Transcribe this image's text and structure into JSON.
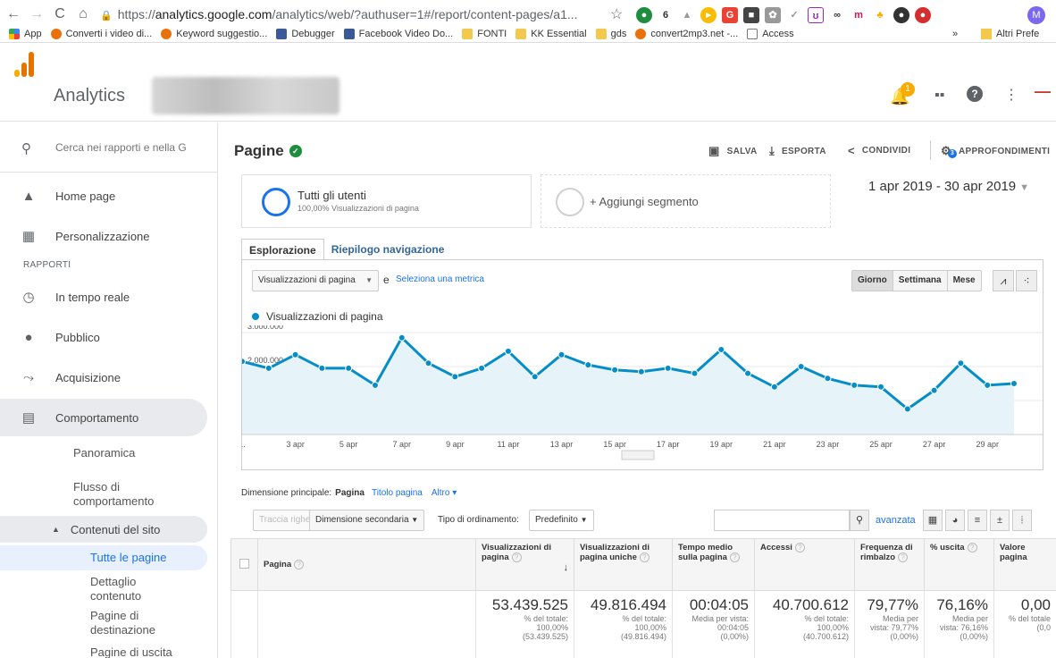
{
  "browser": {
    "url_prefix": "https://",
    "url_host": "analytics.google.com",
    "url_rest": "/analytics/web/?authuser=1#/report/content-pages/a1...",
    "profile_initial": "M",
    "bookmarks": [
      {
        "label": "App",
        "kind": "apps"
      },
      {
        "label": "Converti i video di...",
        "kind": "circ"
      },
      {
        "label": "Keyword suggestio...",
        "kind": "circ"
      },
      {
        "label": "Debugger",
        "kind": "fb"
      },
      {
        "label": "Facebook Video Do...",
        "kind": "fb"
      },
      {
        "label": "FONTI",
        "kind": "fold"
      },
      {
        "label": "KK Essential",
        "kind": "fold"
      },
      {
        "label": "gds",
        "kind": "fold"
      },
      {
        "label": "convert2mp3.net -...",
        "kind": "circ"
      },
      {
        "label": "Access",
        "kind": "doc"
      }
    ],
    "bookmarks_more": "»",
    "bookmarks_other": "Altri Prefe"
  },
  "header": {
    "app_name": "Analytics",
    "notification_count": "1"
  },
  "sidebar": {
    "search_placeholder": "Cerca nei rapporti e nella G",
    "items": [
      {
        "label": "Home page",
        "icon": "home-icon"
      },
      {
        "label": "Personalizzazione",
        "icon": "customization-icon"
      }
    ],
    "section_label": "RAPPORTI",
    "report_items": [
      {
        "label": "In tempo reale",
        "icon": "clock-icon"
      },
      {
        "label": "Pubblico",
        "icon": "person-icon"
      },
      {
        "label": "Acquisizione",
        "icon": "acquisition-icon"
      },
      {
        "label": "Comportamento",
        "icon": "behavior-icon"
      }
    ],
    "behavior_sub": {
      "panoramica": "Panoramica",
      "flusso": "Flusso di comportamento",
      "contenuti": "Contenuti del sito",
      "tutte": "Tutte le pagine",
      "dettaglio": "Dettaglio contenuto",
      "destinazione": "Pagine di destinazione",
      "uscita": "Pagine di uscita"
    }
  },
  "main": {
    "title": "Pagine",
    "toolbar": {
      "save": "SALVA",
      "export": "ESPORTA",
      "share": "CONDIVIDI",
      "insights": "APPROFONDIMENTI",
      "insights_badge": "3"
    },
    "segment": {
      "title": "Tutti gli utenti",
      "subtitle": "100,00% Visualizzazioni di pagina",
      "add": "+ Aggiungi segmento"
    },
    "date_range": "1 apr 2019 - 30 apr 2019",
    "tabs": [
      "Esplorazione",
      "Riepilogo navigazione"
    ],
    "metric_select": "Visualizzazioni di pagina",
    "metric_and": "e",
    "metric_link": "Seleziona una metrica",
    "periods": [
      "Giorno",
      "Settimana",
      "Mese"
    ],
    "dimension": {
      "label": "Dimensione principale:",
      "primary": "Pagina",
      "title_link": "Titolo pagina",
      "more": "Altro ▾"
    },
    "controls": {
      "plot_rows": "Traccia righe",
      "secondary": "Dimensione secondaria",
      "sort_label": "Tipo di ordinamento:",
      "sort_value": "Predefinito",
      "advanced": "avanzata"
    }
  },
  "table": {
    "headers": [
      {
        "label": "Pagina",
        "help": true
      },
      {
        "label": "Visualizzazioni di pagina",
        "help": true,
        "sorted": true
      },
      {
        "label": "Visualizzazioni di pagina uniche",
        "help": true
      },
      {
        "label": "Tempo medio sulla pagina",
        "help": true
      },
      {
        "label": "Accessi",
        "help": true
      },
      {
        "label": "Frequenza di rimbalzo",
        "help": true
      },
      {
        "label": "% uscita",
        "help": true
      },
      {
        "label": "Valore pagina",
        "help": false
      }
    ],
    "totals": [
      {
        "big": "53.439.525",
        "l1": "% del totale:",
        "l2": "100,00%",
        "l3": "(53.439.525)"
      },
      {
        "big": "49.816.494",
        "l1": "% del totale:",
        "l2": "100,00%",
        "l3": "(49.816.494)"
      },
      {
        "big": "00:04:05",
        "l1": "Media per vista:",
        "l2": "00:04:05",
        "l3": "(0,00%)"
      },
      {
        "big": "40.700.612",
        "l1": "% del totale:",
        "l2": "100,00%",
        "l3": "(40.700.612)"
      },
      {
        "big": "79,77%",
        "l1": "Media per",
        "l2": "vista: 79,77%",
        "l3": "(0,00%)"
      },
      {
        "big": "76,16%",
        "l1": "Media per",
        "l2": "vista: 76,16%",
        "l3": "(0,00%)"
      },
      {
        "big": "0,00",
        "l1": "% del totale",
        "l2": "(0,0",
        "l3": ""
      }
    ]
  },
  "chart_data": {
    "type": "line",
    "series": [
      {
        "name": "Visualizzazioni di pagina",
        "color": "#058dc7",
        "values": [
          2150000,
          1950000,
          2350000,
          1950000,
          1950000,
          1450000,
          2850000,
          2100000,
          1700000,
          1950000,
          2450000,
          1700000,
          2350000,
          2050000,
          1900000,
          1850000,
          1950000,
          1800000,
          2500000,
          1800000,
          1400000,
          2000000,
          1650000,
          1450000,
          1400000,
          750000,
          1300000,
          2100000,
          1450000,
          1500000
        ]
      }
    ],
    "x_days": [
      1,
      2,
      3,
      4,
      5,
      6,
      7,
      8,
      9,
      10,
      11,
      12,
      13,
      14,
      15,
      16,
      17,
      18,
      19,
      20,
      21,
      22,
      23,
      24,
      25,
      26,
      27,
      28,
      29,
      30
    ],
    "x_tick_labels": [
      "...",
      "3 apr",
      "5 apr",
      "7 apr",
      "9 apr",
      "11 apr",
      "13 apr",
      "15 apr",
      "17 apr",
      "19 apr",
      "21 apr",
      "23 apr",
      "25 apr",
      "27 apr",
      "29 apr"
    ],
    "y_ticks": [
      "3.000.000",
      "2.000.000",
      "1.000.000"
    ],
    "y_tick_values": [
      3000000,
      2000000,
      1000000
    ],
    "ylim": [
      0,
      3000000
    ],
    "grid": true
  }
}
